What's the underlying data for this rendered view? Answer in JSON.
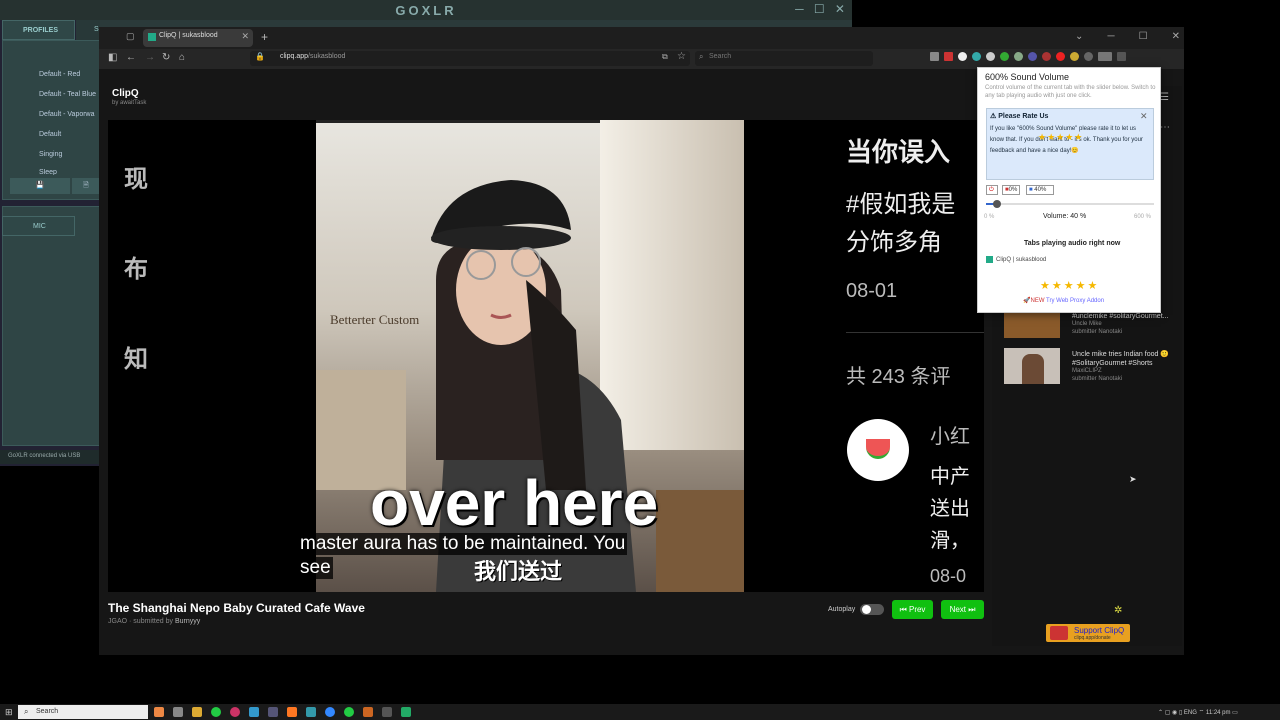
{
  "goxlr": {
    "title": "GOXLR",
    "profiles_tab": "PROFILES",
    "second_tab": "S",
    "profiles": [
      "Default - Red",
      "Default - Teal Blue",
      "Default - Vaporwa",
      "Default",
      "Singing",
      "Sleep"
    ],
    "mic_tab": "MIC",
    "status": "GoXLR connected via USB"
  },
  "browser": {
    "tab_title": "ClipQ | sukasblood",
    "url_host": "clipq.app",
    "url_path": "/sukasblood",
    "search_placeholder": "Search"
  },
  "page": {
    "logo": "ClipQ",
    "logo_by": "by awaitTask",
    "video": {
      "left_chars": [
        "现",
        "布",
        "知"
      ],
      "right_lines": [
        "当你误入",
        "#假如我是",
        "分饰多角",
        "08-01",
        "共 243 条评",
        "小红",
        "中产",
        "送出",
        "滑，",
        "08-0"
      ],
      "sign": "Betterter Custom",
      "overlay_word": "over here",
      "bottom_cn": "我们送过",
      "caption_lines": [
        "master aura has to be maintained. You",
        "see"
      ]
    },
    "title": "The Shanghai Nepo Baby Curated Cafe Wave",
    "channel": "JGAO",
    "submitted_by_label": "submitted by",
    "submitter": "Burnyyy",
    "autoplay_label": "Autoplay",
    "prev_label": "⏮ Prev",
    "next_label": "Next ⏭",
    "queue": [
      {
        "title": "#unclemike #solitaryGourmet...",
        "channel": "Uncle Mike",
        "submitter": "submitter Nanotaki"
      },
      {
        "title": "Uncle mike tries Indian food 🙂 #SolitaryGourmet #Shorts",
        "channel": "MaxiCLIPZ",
        "submitter": "submitter Nanotaki"
      }
    ],
    "support_label": "Support ClipQ",
    "support_sub": "clipq.app/donate"
  },
  "popup": {
    "title": "600% Sound Volume",
    "description": "Control volume of the current tab with the slider below. Switch to any tab playing audio with just one click.",
    "rate_title": "Please Rate Us",
    "rate_text": "If you like \"600% Sound Volume\" please rate it to let us know that. If you don't want to - it's ok. Thank you for your feedback and have a nice day!😊",
    "rate_stars": "★★★★★",
    "preset_mute": "0%",
    "preset_40": "40%",
    "slider_min": "0 %",
    "volume_label": "Volume: 40 %",
    "slider_max": "600 %",
    "volume_fraction": 0.0667,
    "tabs_heading": "Tabs playing audio right now",
    "tab_entry": "ClipQ | sukasblood",
    "bottom_stars": "★★★★★",
    "proxy_new": "NEW",
    "proxy_link": "Try Web Proxy Addon"
  },
  "taskbar": {
    "search_placeholder": "Search",
    "lang": "ENG",
    "time": "11:24 pm"
  }
}
